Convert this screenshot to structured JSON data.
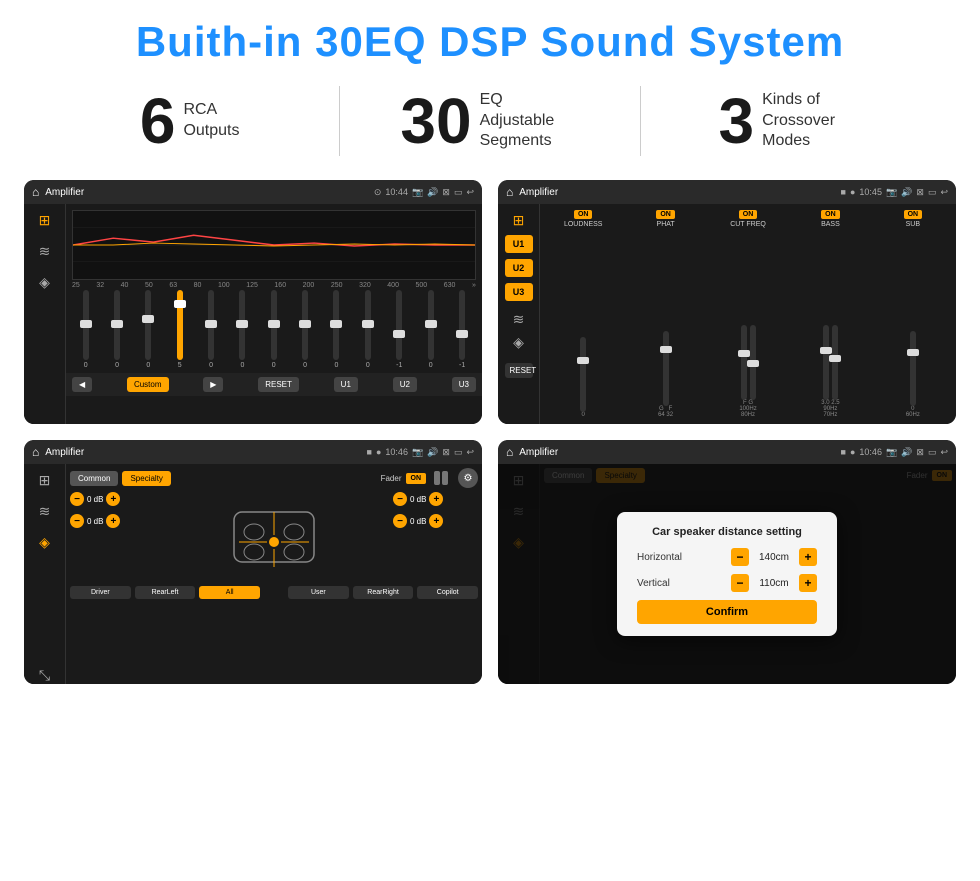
{
  "header": {
    "title": "Buith-in 30EQ DSP Sound System"
  },
  "stats": [
    {
      "number": "6",
      "text_line1": "RCA",
      "text_line2": "Outputs"
    },
    {
      "number": "30",
      "text_line1": "EQ Adjustable",
      "text_line2": "Segments"
    },
    {
      "number": "3",
      "text_line1": "Kinds of",
      "text_line2": "Crossover Modes"
    }
  ],
  "screens": [
    {
      "id": "screen1",
      "bar": {
        "title": "Amplifier",
        "time": "10:44"
      },
      "type": "eq"
    },
    {
      "id": "screen2",
      "bar": {
        "title": "Amplifier",
        "time": "10:45"
      },
      "type": "segments"
    },
    {
      "id": "screen3",
      "bar": {
        "title": "Amplifier",
        "time": "10:46"
      },
      "type": "fader"
    },
    {
      "id": "screen4",
      "bar": {
        "title": "Amplifier",
        "time": "10:46"
      },
      "type": "dialog"
    }
  ],
  "eq": {
    "freqs": [
      "25",
      "32",
      "40",
      "50",
      "63",
      "80",
      "100",
      "125",
      "160",
      "200",
      "250",
      "320",
      "400",
      "500",
      "630"
    ],
    "values": [
      "0",
      "0",
      "0",
      "5",
      "0",
      "0",
      "0",
      "0",
      "0",
      "0",
      "-1",
      "0",
      "-1"
    ],
    "buttons": [
      "◀",
      "Custom",
      "▶",
      "RESET",
      "U1",
      "U2",
      "U3"
    ]
  },
  "segments": {
    "presets": [
      "U1",
      "U2",
      "U3"
    ],
    "columns": [
      {
        "label": "LOUDNESS",
        "on": true
      },
      {
        "label": "PHAT",
        "on": true
      },
      {
        "label": "CUT FREQ",
        "on": true
      },
      {
        "label": "BASS",
        "on": true
      },
      {
        "label": "SUB",
        "on": true
      }
    ],
    "reset": "RESET"
  },
  "fader": {
    "modes": [
      "Common",
      "Specialty"
    ],
    "fader_label": "Fader",
    "on_label": "ON",
    "db_values": [
      "0 dB",
      "0 dB",
      "0 dB",
      "0 dB"
    ],
    "bottom_btns": [
      "Driver",
      "RearLeft",
      "All",
      "User",
      "RearRight",
      "Copilot"
    ]
  },
  "dialog": {
    "title": "Car speaker distance setting",
    "horizontal_label": "Horizontal",
    "horizontal_value": "140cm",
    "vertical_label": "Vertical",
    "vertical_value": "110cm",
    "confirm_label": "Confirm"
  }
}
